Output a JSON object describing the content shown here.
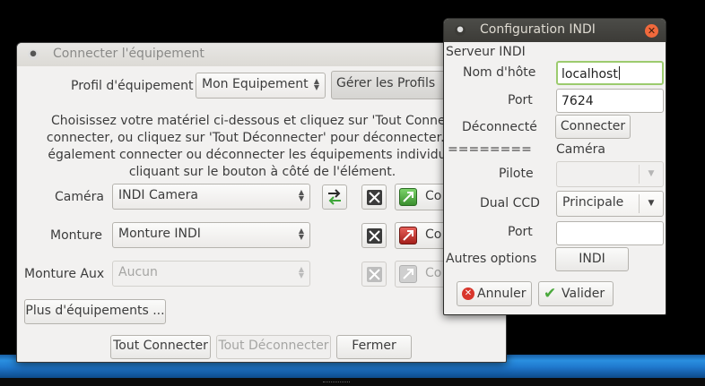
{
  "connect_window": {
    "title": "Connecter l'équipement",
    "profile_label": "Profil d'équipement",
    "profile_value": "Mon Equipement",
    "manage_profiles_label": "Gérer les Profils",
    "instructions": [
      "Choisissez votre matériel ci-dessous et cliquez sur 'Tout Connecter' po",
      "connecter, ou cliquez sur 'Tout Déconnecter' pour déconnecter. Vous po",
      "également connecter ou déconnecter les équipements individuellemen",
      "cliquant sur le bouton à côté de l'élément."
    ],
    "devices": [
      {
        "label": "Caméra",
        "value": "INDI Camera",
        "connect_label": "Co"
      },
      {
        "label": "Monture",
        "value": "Monture INDI",
        "connect_label": "Co"
      },
      {
        "label": "Monture Aux",
        "value": "Aucun",
        "connect_label": "Co"
      }
    ],
    "more_devices_label": "Plus d'équipements ...",
    "connect_all_label": "Tout Connecter",
    "disconnect_all_label": "Tout Déconnecter",
    "close_label": "Fermer"
  },
  "indi_window": {
    "title": "Configuration INDI",
    "server_section": "Serveur INDI",
    "hostname_label": "Nom d'hôte",
    "hostname_value": "localhost",
    "port_label": "Port",
    "port_value": "7624",
    "status_label": "Déconnecté",
    "connect_label": "Connecter",
    "separator": "========",
    "camera_section": "Caméra",
    "driver_label": "Pilote",
    "driver_value": "",
    "dual_ccd_label": "Dual CCD",
    "dual_ccd_value": "Principale",
    "port2_label": "Port",
    "port2_value": "",
    "other_options_label": "Autres options",
    "indi_button_label": "INDI",
    "cancel_label": "Annuler",
    "ok_label": "Valider"
  },
  "colors": {
    "active_titlebar": "#3c3b37",
    "close_button": "#f0693c",
    "focus_border": "#9ccb6e",
    "taskbar_blue": "#1f77cc"
  }
}
